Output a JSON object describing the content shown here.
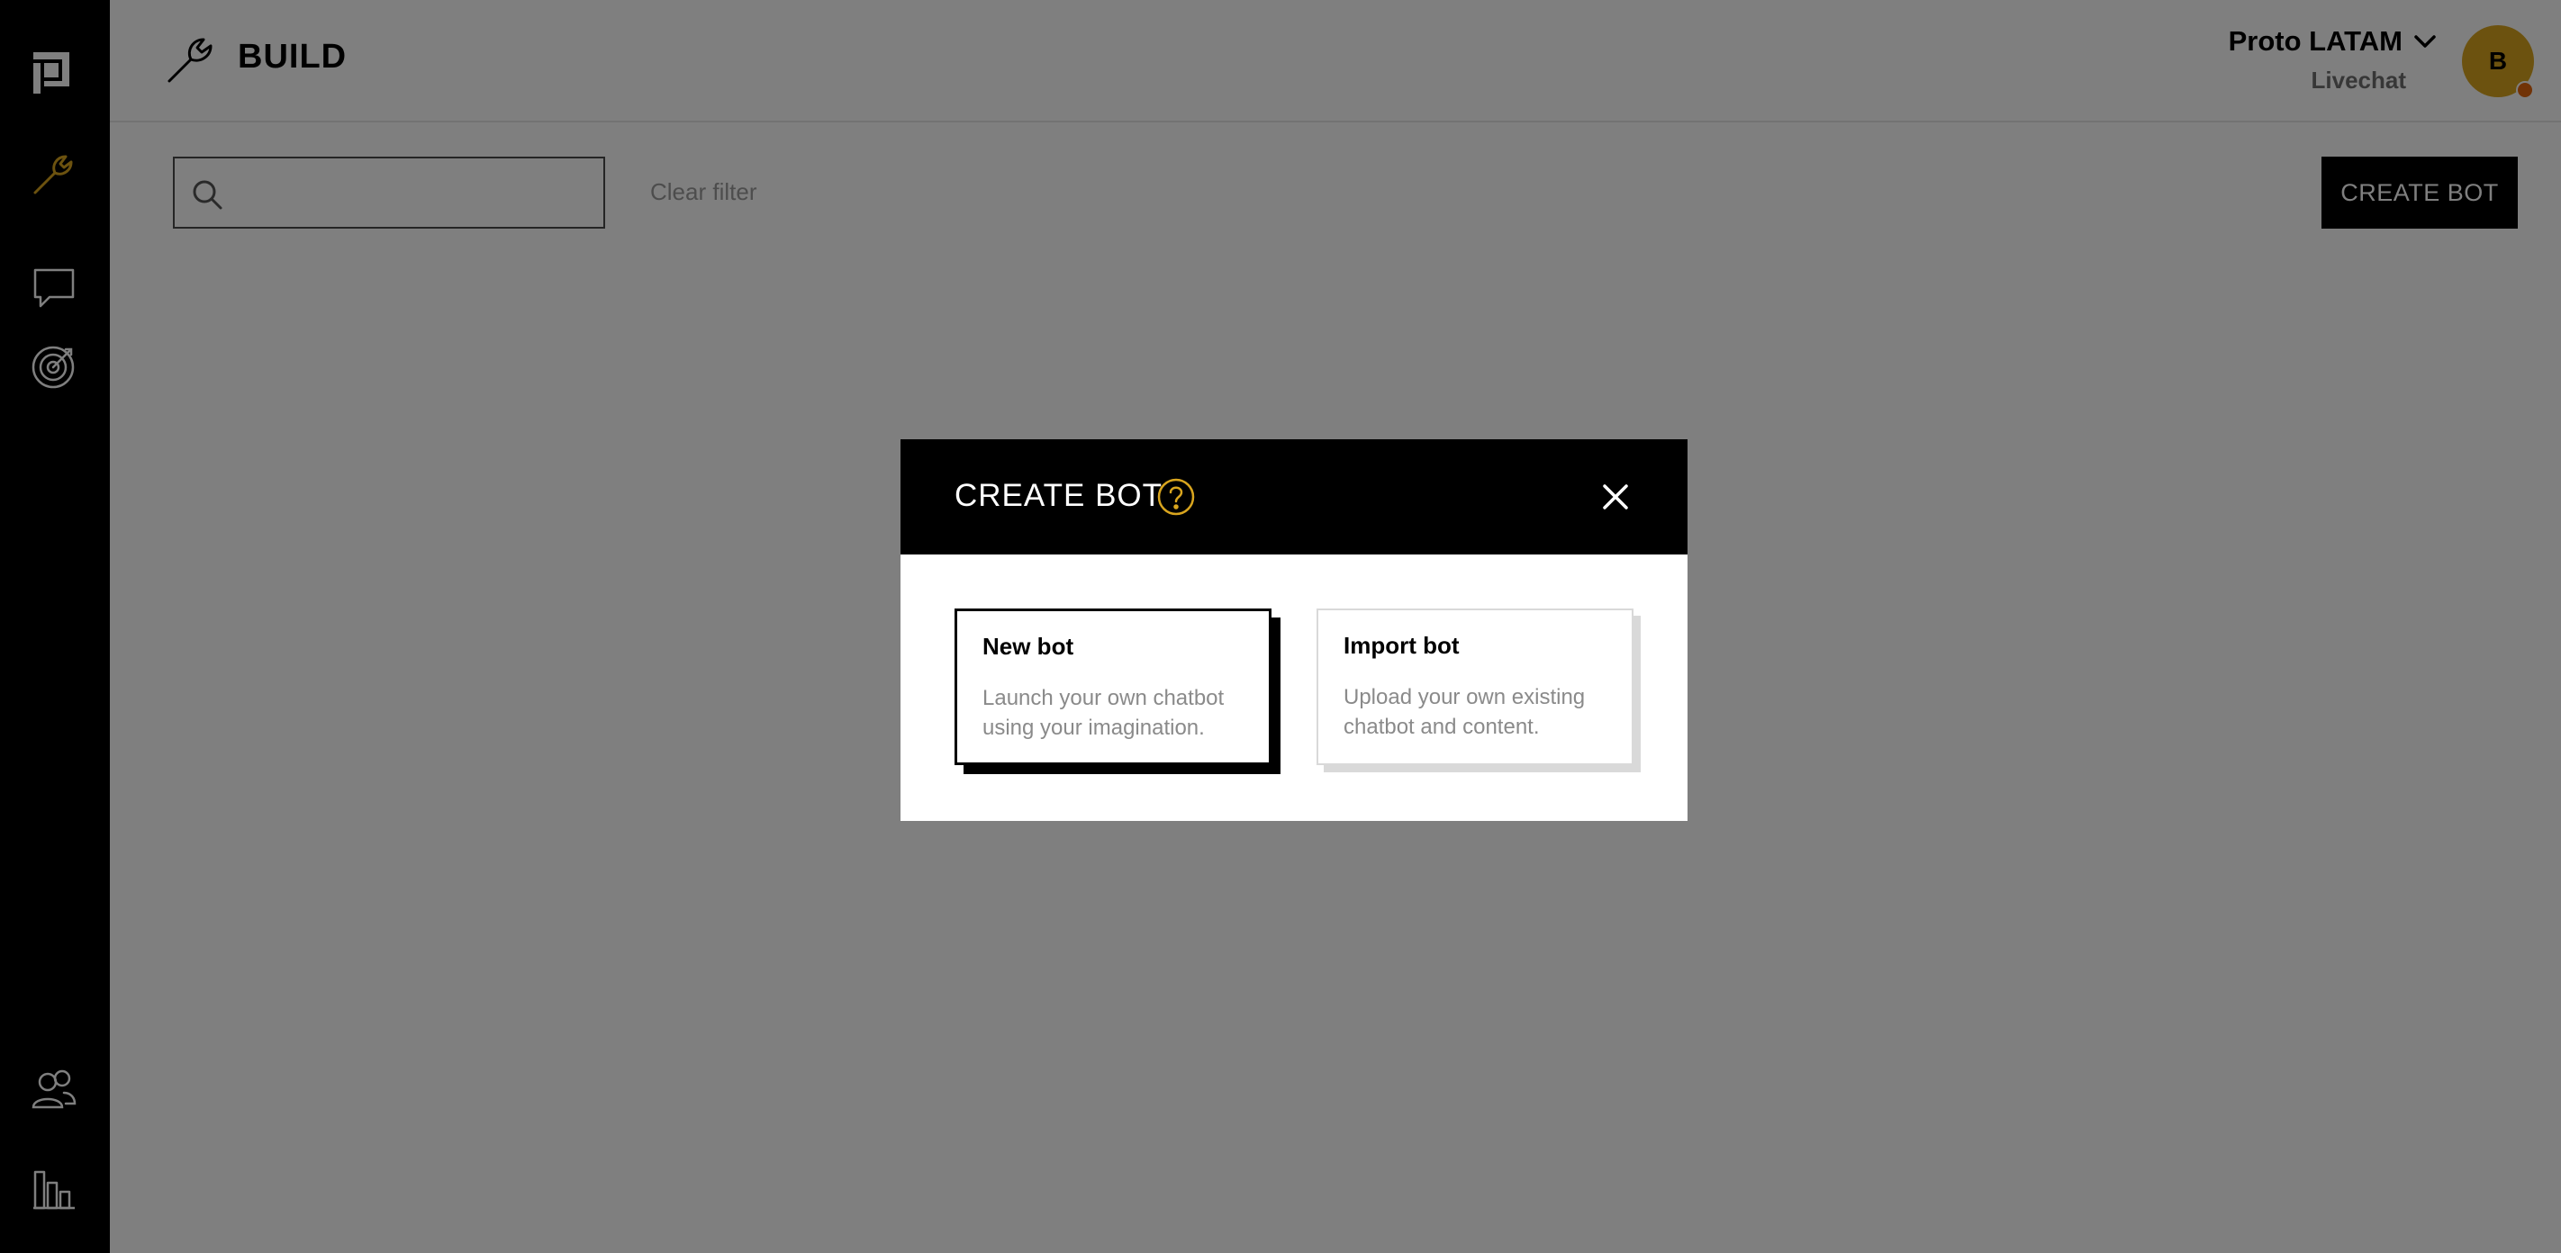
{
  "header": {
    "page_title": "BUILD",
    "org_name": "Proto LATAM",
    "org_subtitle": "Livechat",
    "avatar_initial": "B"
  },
  "sidebar": {
    "items": [
      {
        "icon": "logo-icon"
      },
      {
        "icon": "wrench-icon",
        "active": true
      },
      {
        "icon": "chat-icon"
      },
      {
        "icon": "target-icon"
      },
      {
        "icon": "users-icon"
      },
      {
        "icon": "bar-chart-icon"
      }
    ]
  },
  "toolbar": {
    "search_value": "",
    "search_placeholder": "",
    "clear_filter_label": "Clear filter",
    "create_button_label": "CREATE BOT"
  },
  "modal": {
    "title": "CREATE BOT",
    "options": [
      {
        "title": "New bot",
        "description": "Launch your own chatbot using your imagination.",
        "selected": true
      },
      {
        "title": "Import bot",
        "description": "Upload your own existing chatbot and content.",
        "selected": false
      }
    ]
  },
  "colors": {
    "accent": "#d9a51e",
    "sidebar_bg": "#000000",
    "status_dot": "#e2670e",
    "overlay": "rgba(0,0,0,0.5)"
  }
}
